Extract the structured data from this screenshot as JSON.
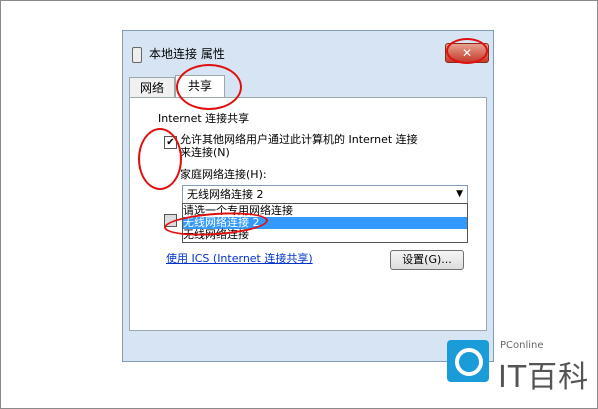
{
  "window": {
    "title": "本地连接 属性",
    "close": "✕"
  },
  "tabs": [
    {
      "label": "网络"
    },
    {
      "label": "共享"
    }
  ],
  "sharing": {
    "group_label": "Internet 连接共享",
    "allow_checked": true,
    "allow_text_line1": "允许其他网络用户通过此计算机的 Internet 连接",
    "allow_text_line2": "来连接(N)",
    "home_network_label": "家庭网络连接(H):",
    "selected_value": "无线网络连接 2",
    "dropdown_options": [
      {
        "label": "请选一个专用网络连接"
      },
      {
        "label": "无线网络连接 2"
      },
      {
        "label": "无线网络连接"
      }
    ],
    "ics_link": "使用 ICS (Internet 连接共享)",
    "settings_button": "设置(G)..."
  },
  "watermark": {
    "small": "PConline",
    "big": "IT百科"
  },
  "colors": {
    "annotation": "#e01010",
    "selection": "#3399ff",
    "logo": "#1a9cd8"
  }
}
